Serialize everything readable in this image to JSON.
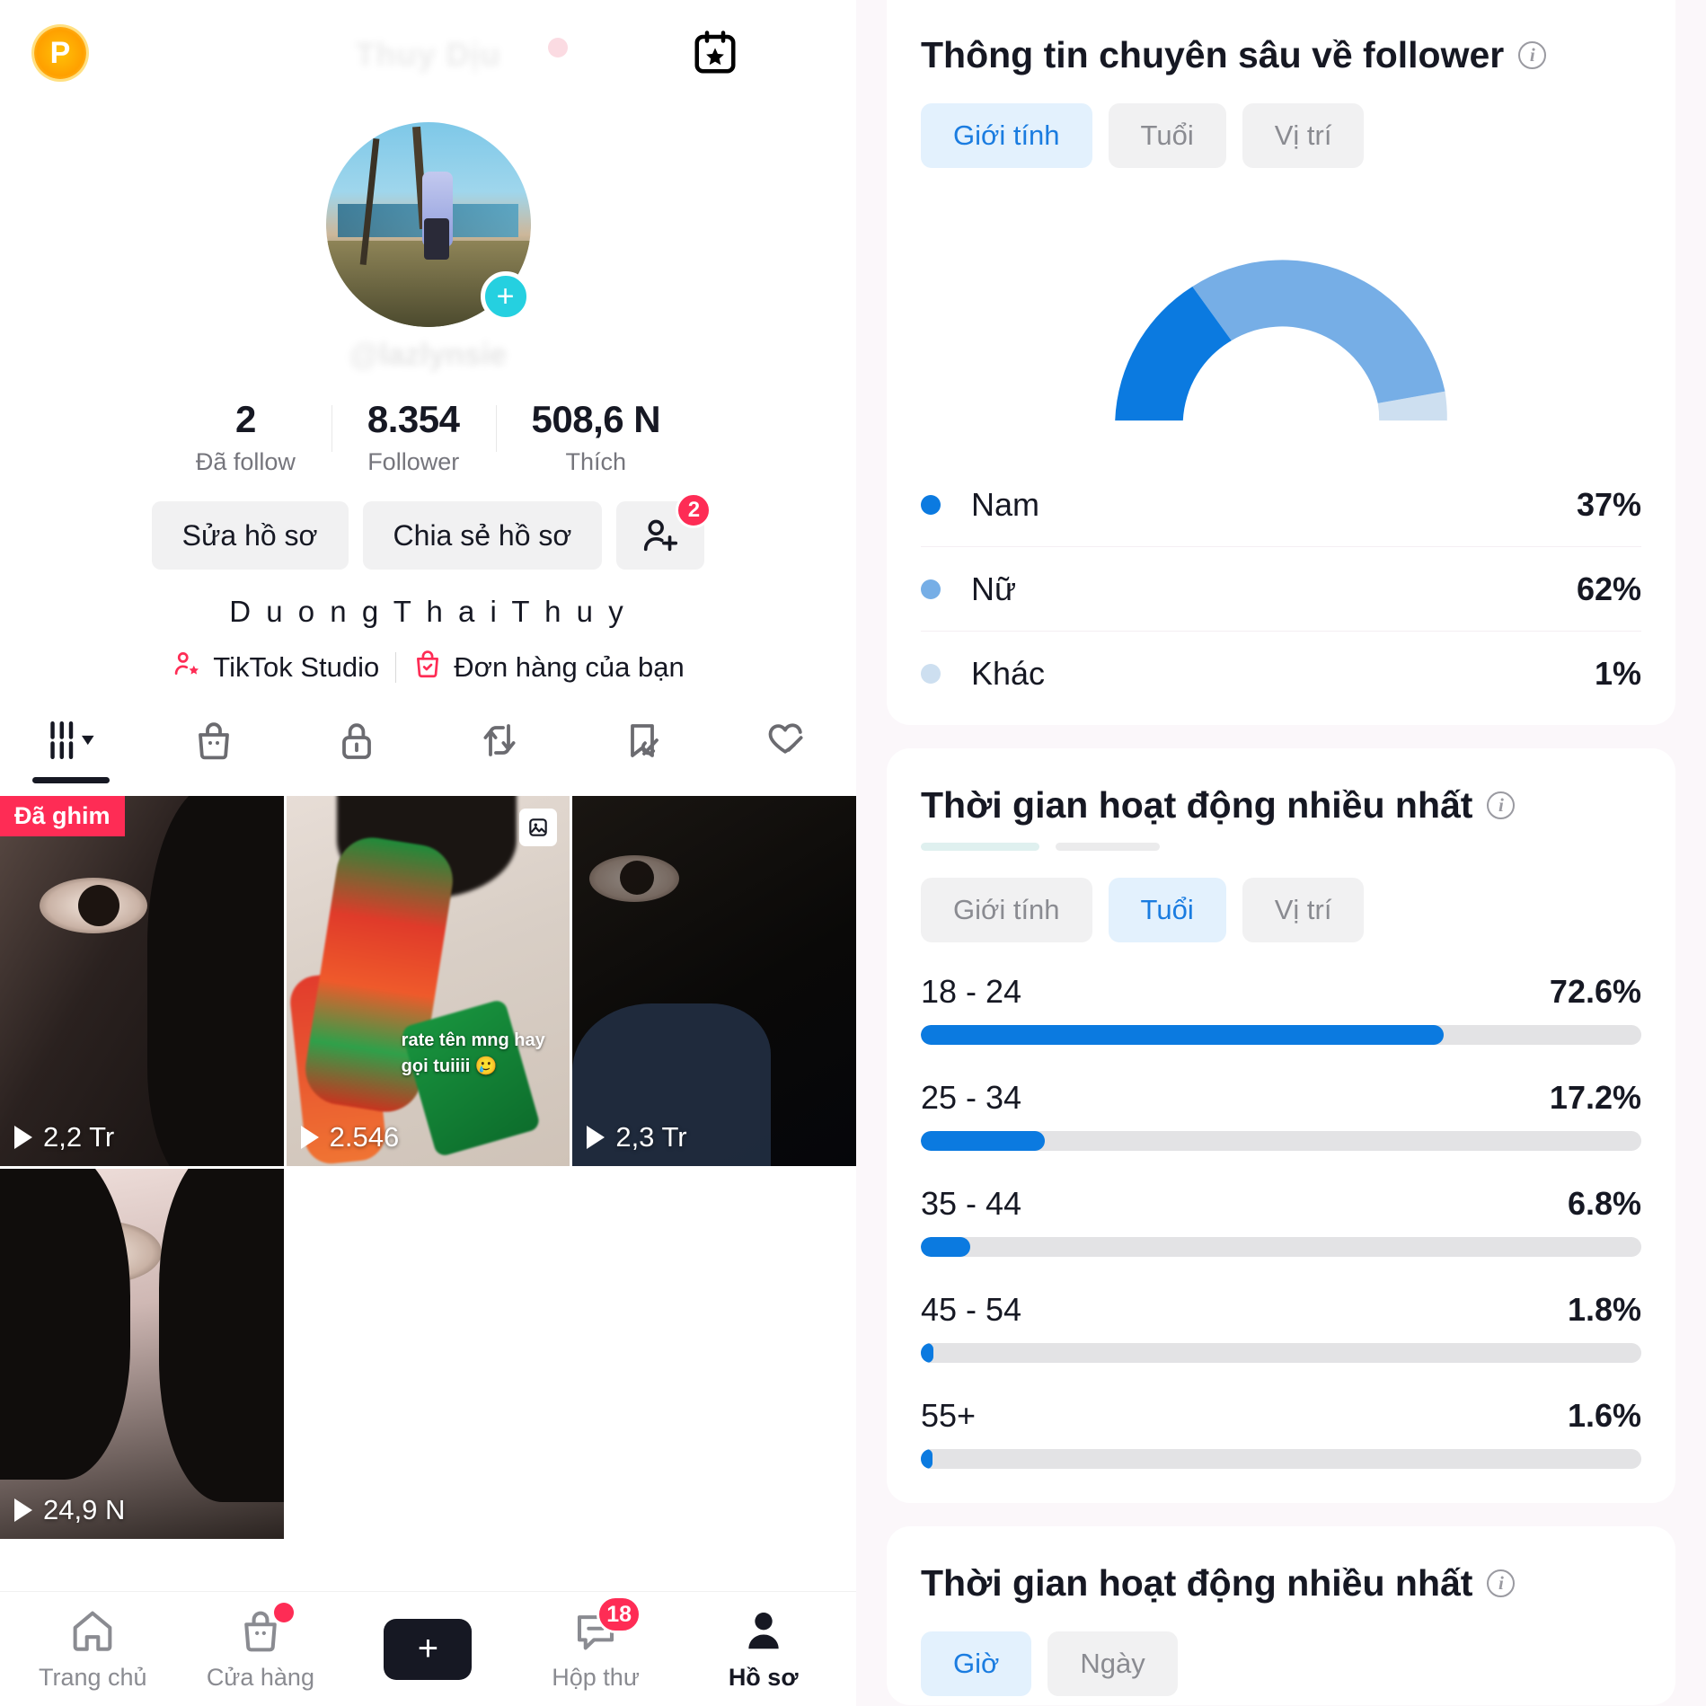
{
  "left_panel": {
    "header": {
      "badge_letter": "P",
      "title_blurred": "Thuy Dịu",
      "bookmark_icon": "calendar-star-icon",
      "menu_icon": "hamburger-menu-icon"
    },
    "profile": {
      "handle_blurred": "@lazlynsie",
      "display_name": "D u o n g T h a i T h u y",
      "add_friend_badge": "2"
    },
    "stats": [
      {
        "value": "2",
        "label": "Đã follow"
      },
      {
        "value": "8.354",
        "label": "Follower"
      },
      {
        "value": "508,6 N",
        "label": "Thích"
      }
    ],
    "buttons": {
      "edit_profile": "Sửa hồ sơ",
      "share_profile": "Chia sẻ hồ sơ"
    },
    "links": [
      {
        "label": "TikTok Studio",
        "icon": "person-star-icon"
      },
      {
        "label": "Đơn hàng của bạn",
        "icon": "shopping-bag-check-icon"
      }
    ],
    "tabs": [
      {
        "icon": "grid-posts-icon",
        "active": true
      },
      {
        "icon": "shopping-bag-icon",
        "active": false
      },
      {
        "icon": "lock-private-icon",
        "active": false
      },
      {
        "icon": "repost-icon",
        "active": false
      },
      {
        "icon": "bookmark-off-icon",
        "active": false
      },
      {
        "icon": "heart-off-icon",
        "active": false
      }
    ],
    "videos": [
      {
        "pinned_label": "Đã ghim",
        "views": "2,2 Tr",
        "has_image_icon": false,
        "overlay_text": ""
      },
      {
        "pinned_label": "",
        "views": "2.546",
        "has_image_icon": true,
        "overlay_text": "rate tên mng hay gọi tuiiii 🥲"
      },
      {
        "pinned_label": "",
        "views": "2,3 Tr",
        "has_image_icon": false,
        "overlay_text": ""
      },
      {
        "pinned_label": "",
        "views": "24,9 N",
        "has_image_icon": false,
        "overlay_text": ""
      }
    ],
    "bottom_nav": [
      {
        "label": "Trang chủ",
        "icon": "home-icon",
        "active": false,
        "badge": ""
      },
      {
        "label": "Cửa hàng",
        "icon": "shop-bag-icon",
        "active": false,
        "badge": "dot"
      },
      {
        "label": "",
        "icon": "create-plus-icon",
        "active": false,
        "badge": ""
      },
      {
        "label": "Hộp thư",
        "icon": "inbox-message-icon",
        "active": false,
        "badge": "18"
      },
      {
        "label": "Hồ sơ",
        "icon": "profile-person-icon",
        "active": true,
        "badge": ""
      }
    ]
  },
  "right_panel": {
    "follower_insights": {
      "title": "Thông tin chuyên sâu về follower",
      "info_icon": "info-circle-icon",
      "segments": [
        {
          "label": "Giới tính",
          "active": true
        },
        {
          "label": "Tuổi",
          "active": false
        },
        {
          "label": "Vị trí",
          "active": false
        }
      ]
    },
    "active_time_age": {
      "title": "Thời gian hoạt động nhiều nhất",
      "info_icon": "info-circle-icon",
      "segments": [
        {
          "label": "Giới tính",
          "active": false
        },
        {
          "label": "Tuổi",
          "active": true
        },
        {
          "label": "Vị trí",
          "active": false
        }
      ]
    },
    "active_time_hours": {
      "title": "Thời gian hoạt động nhiều nhất",
      "info_icon": "info-circle-icon",
      "segments": [
        {
          "label": "Giờ",
          "active": true
        },
        {
          "label": "Ngày",
          "active": false
        }
      ]
    },
    "colors": {
      "primary_blue": "#0b7ae0",
      "secondary_blue": "#76aee6",
      "tertiary_blue": "#cddff0",
      "accent_pink": "#fe2c55",
      "track_grey": "#e3e3e5"
    }
  },
  "chart_data": [
    {
      "type": "pie",
      "title": "Thông tin chuyên sâu về follower — Giới tính",
      "subtype": "semicircle-gauge",
      "categories": [
        "Nam",
        "Nữ",
        "Khác"
      ],
      "values": [
        37,
        62,
        1
      ],
      "value_labels": [
        "37%",
        "62%",
        "1%"
      ],
      "colors": [
        "#0b7ae0",
        "#76aee6",
        "#cddff0"
      ],
      "legend": "below",
      "unit": "%"
    },
    {
      "type": "bar",
      "orientation": "horizontal",
      "title": "Thời gian hoạt động nhiều nhất — Tuổi",
      "categories": [
        "18 - 24",
        "25 - 34",
        "35 - 44",
        "45 - 54",
        "55+"
      ],
      "values": [
        72.6,
        17.2,
        6.8,
        1.8,
        1.6
      ],
      "value_labels": [
        "72.6%",
        "17.2%",
        "6.8%",
        "1.8%",
        "1.6%"
      ],
      "xlim": [
        0,
        100
      ],
      "ylabel": "",
      "xlabel": "",
      "grid": false,
      "bar_color": "#0b7ae0",
      "track_color": "#e3e3e5"
    }
  ]
}
